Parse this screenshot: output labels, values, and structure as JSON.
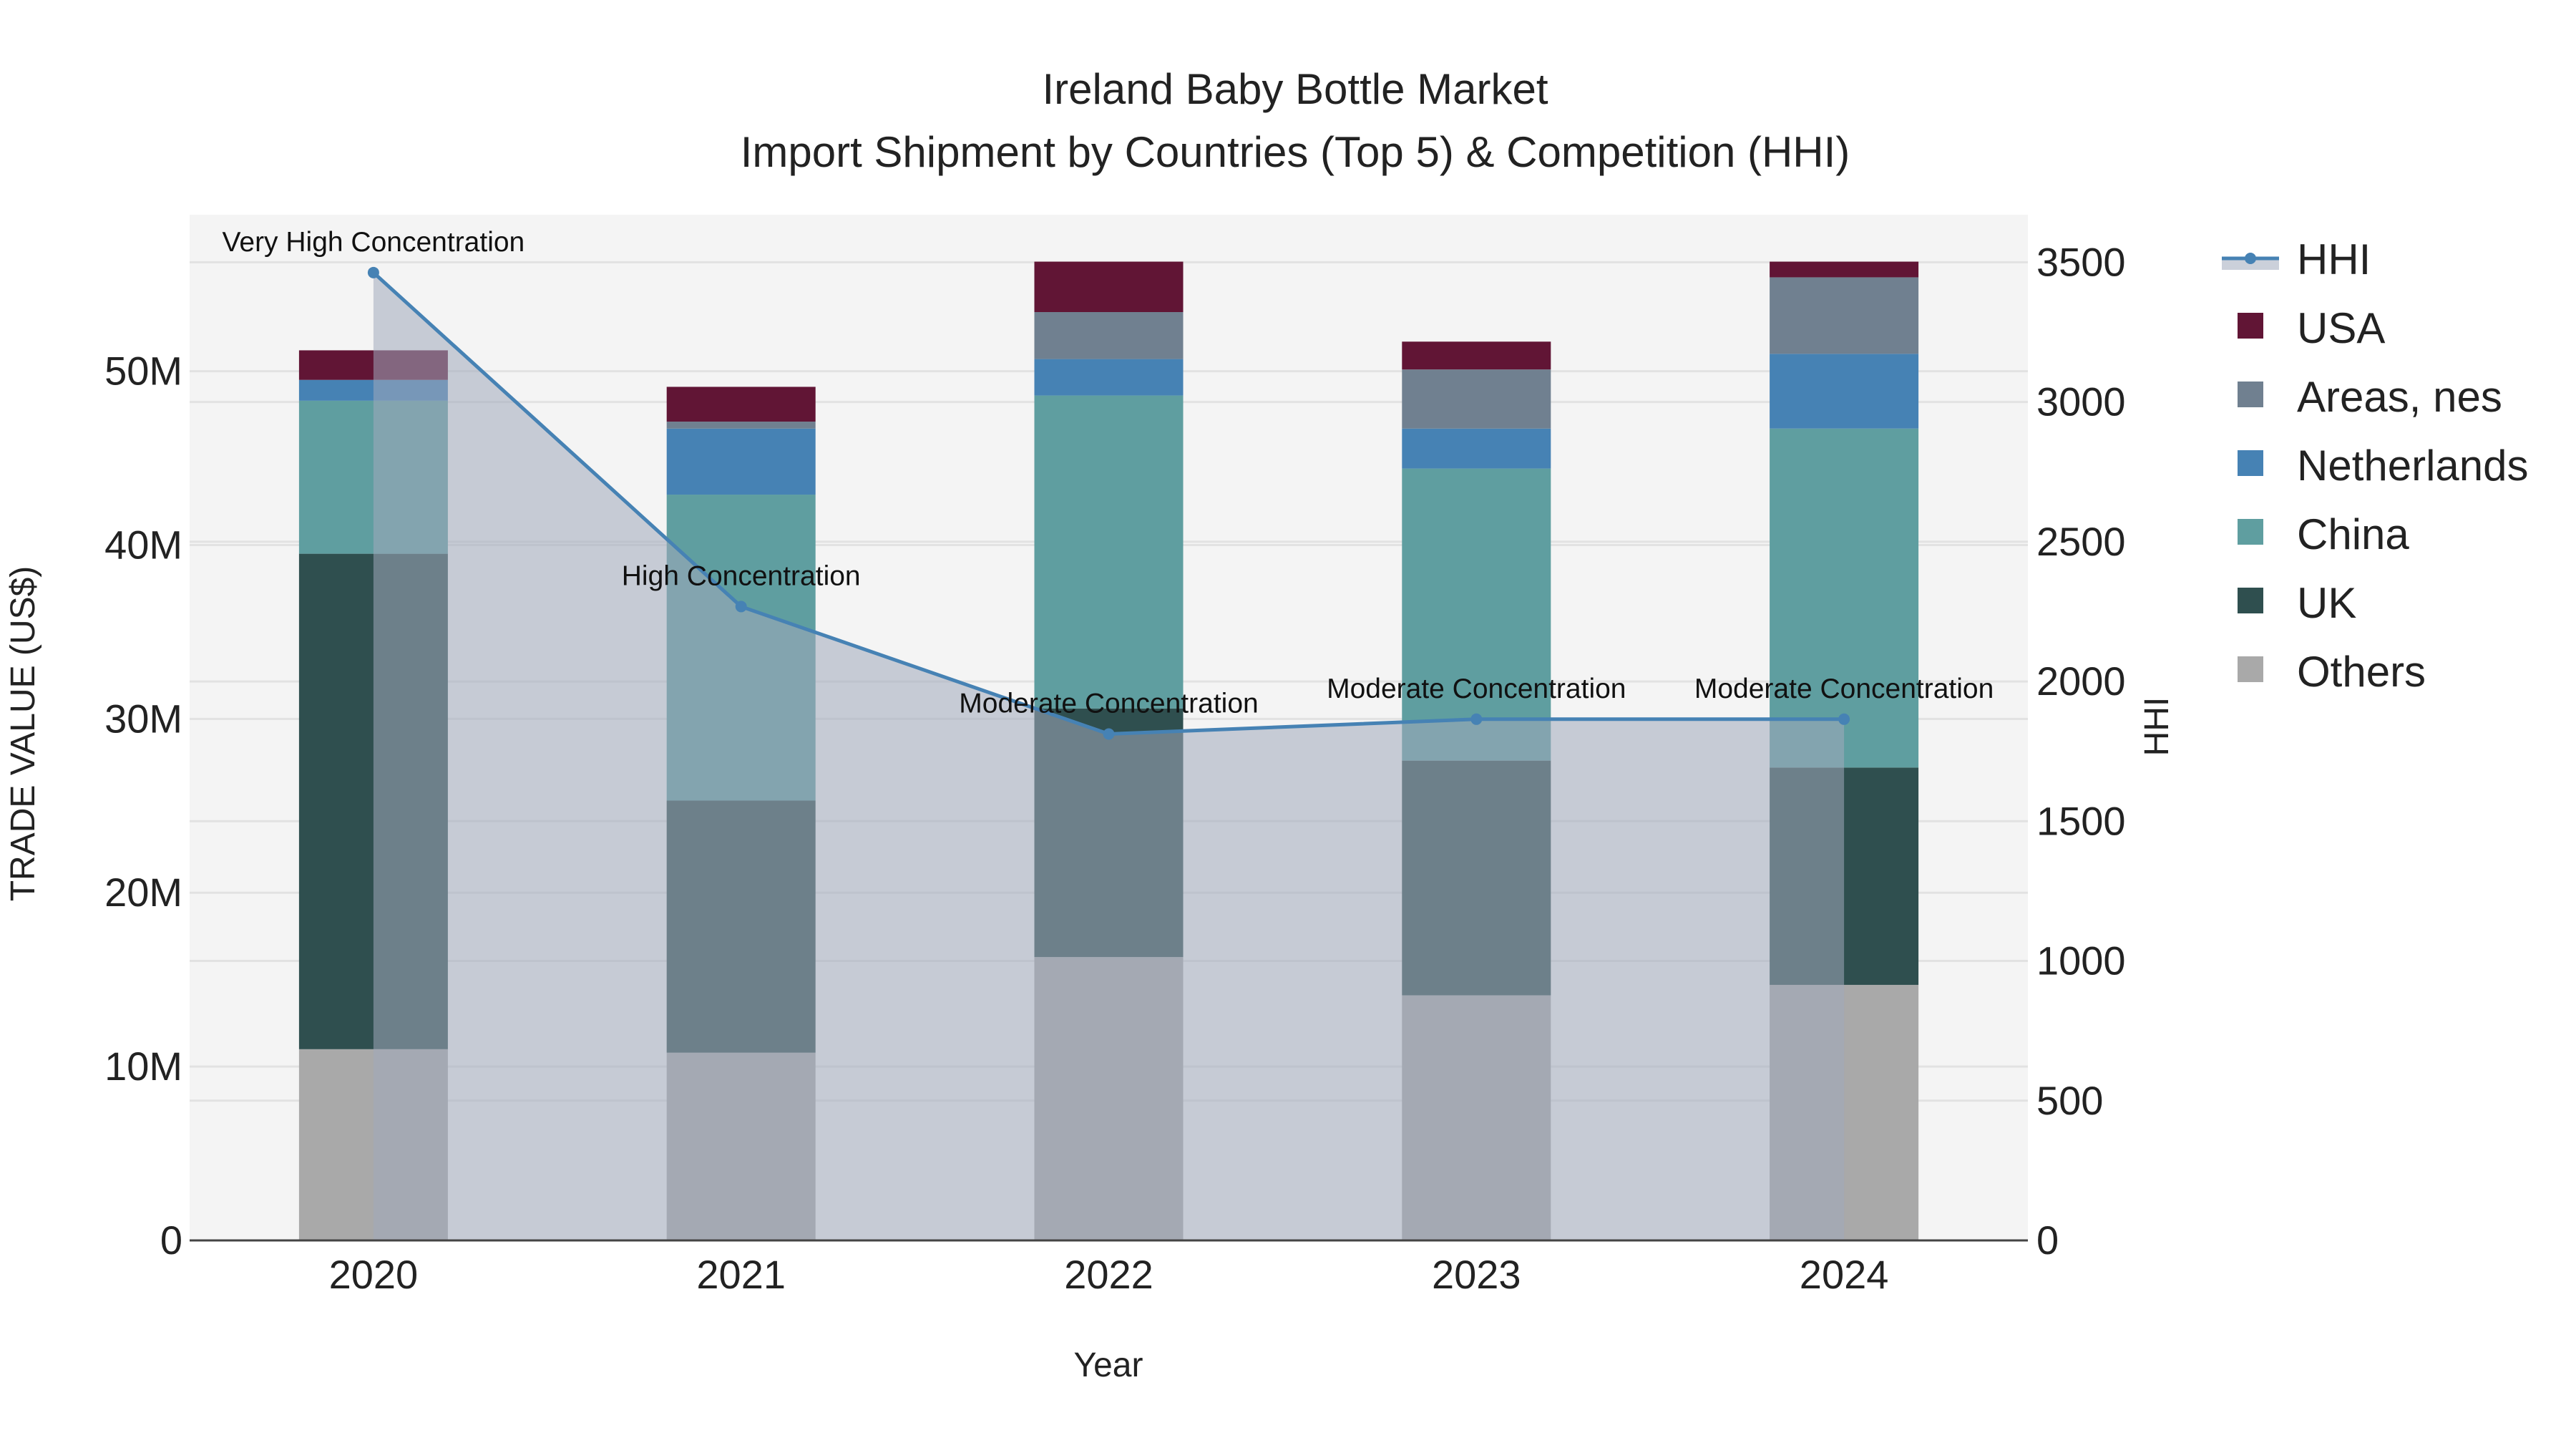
{
  "chart_data": {
    "type": "bar",
    "title": "Ireland Baby Bottle Market",
    "subtitle": "Import Shipment by Countries (Top 5) & Competition (HHI)",
    "xlabel": "Year",
    "ylabel": "TRADE VALUE (US$)",
    "y2label": "HHI",
    "categories": [
      "2020",
      "2021",
      "2022",
      "2023",
      "2024"
    ],
    "ylim": [
      0,
      59
    ],
    "y_ticks": [
      0,
      10,
      20,
      30,
      40,
      50
    ],
    "y_tick_labels": [
      "0",
      "10M",
      "20M",
      "30M",
      "40M",
      "50M"
    ],
    "y2lim": [
      0,
      3670
    ],
    "y2_ticks": [
      0,
      500,
      1000,
      1500,
      2000,
      2500,
      3000,
      3500
    ],
    "y2_tick_labels": [
      "0",
      "500",
      "1000",
      "1500",
      "2000",
      "2500",
      "3000",
      "3500"
    ],
    "units": "US$ millions",
    "series": [
      {
        "name": "Others",
        "color": "#a9a9a9",
        "values": [
          11.0,
          10.8,
          16.3,
          14.1,
          14.7
        ]
      },
      {
        "name": "UK",
        "color": "#2f4f4f",
        "values": [
          28.5,
          14.5,
          14.3,
          13.5,
          12.5
        ]
      },
      {
        "name": "China",
        "color": "#5f9ea0",
        "values": [
          8.8,
          17.6,
          18.0,
          16.8,
          19.5
        ]
      },
      {
        "name": "Netherlands",
        "color": "#4682b4",
        "values": [
          1.2,
          3.8,
          2.1,
          2.3,
          4.3
        ]
      },
      {
        "name": "Areas, nes",
        "color": "#708090",
        "values": [
          0.0,
          0.4,
          2.7,
          3.4,
          4.4
        ]
      },
      {
        "name": "USA",
        "color": "#611535",
        "values": [
          1.7,
          2.0,
          2.9,
          1.6,
          0.9
        ]
      }
    ],
    "hhi": {
      "name": "HHI",
      "color": "#4682b4",
      "values": [
        3463,
        2268,
        1812,
        1865,
        1865
      ],
      "annotations": [
        "Very High Concentration",
        "High Concentration",
        "Moderate Concentration",
        "Moderate Concentration",
        "Moderate Concentration"
      ]
    },
    "legend_order": [
      "HHI",
      "USA",
      "Areas, nes",
      "Netherlands",
      "China",
      "UK",
      "Others"
    ],
    "legend_position": "right",
    "grid": true
  }
}
